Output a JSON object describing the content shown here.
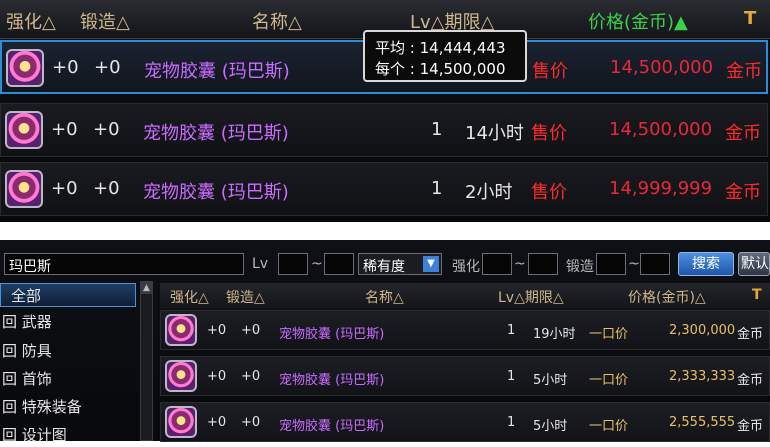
{
  "top_table": {
    "headers": {
      "enhance": "强化△",
      "forge": "锻造△",
      "name": "名称△",
      "lv_limit": "Lv△期限△",
      "price": "价格(金币)▲",
      "hammer": "T"
    },
    "rows": [
      {
        "enhance": "+0",
        "forge": "+0",
        "name": "宠物胶囊 (玛巴斯)",
        "lv": "",
        "time": "",
        "sale": "售价",
        "price": "14,500,000",
        "currency": "金币"
      },
      {
        "enhance": "+0",
        "forge": "+0",
        "name": "宠物胶囊 (玛巴斯)",
        "lv": "1",
        "time": "14小时",
        "sale": "售价",
        "price": "14,500,000",
        "currency": "金币"
      },
      {
        "enhance": "+0",
        "forge": "+0",
        "name": "宠物胶囊 (玛巴斯)",
        "lv": "1",
        "time": "2小时",
        "sale": "售价",
        "price": "14,999,999",
        "currency": "金币"
      }
    ],
    "tooltip": {
      "avg_label": "平均",
      "avg_value": ": 14,444,443",
      "each_label": "每个",
      "each_value": ": 14,500,000"
    }
  },
  "search_bar": {
    "query": "玛巴斯",
    "lv_label": "Lv",
    "tilde": "~",
    "rarity": "稀有度",
    "enhance_label": "强化",
    "forge_label": "锻造",
    "search_button": "搜索",
    "default_button": "默认"
  },
  "sidebar": {
    "items": [
      {
        "label": "全部",
        "selected": true
      },
      {
        "label": "回 武器"
      },
      {
        "label": "回 防具"
      },
      {
        "label": "回 首饰"
      },
      {
        "label": "回 特殊装备"
      },
      {
        "label": "回 设计图"
      }
    ]
  },
  "bottom_table": {
    "headers": {
      "enhance": "强化△",
      "forge": "锻造△",
      "name": "名称△",
      "lv_limit": "Lv△期限△",
      "price": "价格(金币)△",
      "hammer": "T"
    },
    "rows": [
      {
        "enhance": "+0",
        "forge": "+0",
        "name": "宠物胶囊 (玛巴斯)",
        "lv": "1",
        "time": "19小时",
        "sale": "一口价",
        "price": "2,300,000",
        "currency": "金币"
      },
      {
        "enhance": "+0",
        "forge": "+0",
        "name": "宠物胶囊 (玛巴斯)",
        "lv": "1",
        "time": "5小时",
        "sale": "一口价",
        "price": "2,333,333",
        "currency": "金币"
      },
      {
        "enhance": "+0",
        "forge": "+0",
        "name": "宠物胶囊 (玛巴斯)",
        "lv": "1",
        "time": "5小时",
        "sale": "一口价",
        "price": "2,555,555",
        "currency": "金币"
      }
    ]
  },
  "colors": {
    "accent_blue": "#2e8bd6",
    "price_red": "#e8283a",
    "name_purple": "#c86cff",
    "header_gold": "#cfb78a",
    "sort_active_green": "#3ad04a"
  }
}
